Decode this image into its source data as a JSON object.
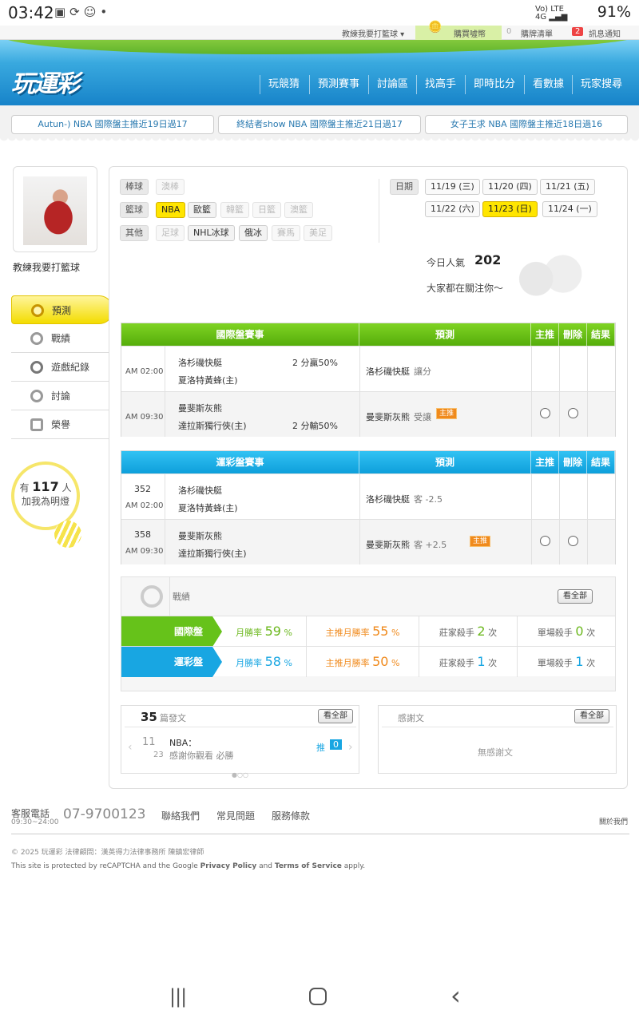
{
  "status": {
    "time": "03:42",
    "battery": "91%",
    "net1": "Vo) LTE",
    "net2": "4G"
  },
  "topbar": {
    "user": "教練我要打籃球 ▾",
    "coins": "購買噓幣",
    "cart": "購牌清單",
    "cart_count": "0",
    "notify_count": "2",
    "notify": "訊息通知"
  },
  "header": {
    "logo": "玩運彩",
    "nav": [
      "玩競猜",
      "預測賽事",
      "討論區",
      "找高手",
      "即時比分",
      "看數據",
      "玩家搜尋"
    ]
  },
  "ticker": [
    "Autun-)  NBA  國際盤主推近19日過17",
    "終結者show  NBA  國際盤主推近21日過17",
    "女子王求  NBA  國際盤主推近18日過16"
  ],
  "profile": {
    "name": "教練我要打籃球"
  },
  "sidemenu": [
    "預測",
    "戰績",
    "遊戲紀錄",
    "討論",
    "榮譽"
  ],
  "fans": {
    "prefix": "有",
    "count": "117",
    "suffix": "人",
    "line2": "加我為明燈"
  },
  "filters": {
    "baseball_label": "棒球",
    "baseball": [
      "澳棒"
    ],
    "basketball_label": "籃球",
    "basketball": [
      "NBA",
      "歐籃",
      "韓籃",
      "日籃",
      "澳籃"
    ],
    "other_label": "其他",
    "other": [
      "足球",
      "NHL冰球",
      "俄冰",
      "賽馬",
      "美足"
    ],
    "date_label": "日期",
    "dates": [
      "11/19 (三)",
      "11/20 (四)",
      "11/21 (五)",
      "11/22 (六)",
      "11/23 (日)",
      "11/24 (一)"
    ]
  },
  "popularity": {
    "label": "今日人氣",
    "value": "202",
    "sub": "大家都在關注你～"
  },
  "intl_table": {
    "headers": [
      "國際盤賽事",
      "預測",
      "主推",
      "刪除",
      "結果"
    ],
    "rows": [
      {
        "time": "AM 02:00",
        "team1": "洛杉磯快艇",
        "team2": "夏洛特黃蜂(主)",
        "odds": "2 分贏50%",
        "pick": "洛杉磯快艇",
        "pick_type": "讓分",
        "main": ""
      },
      {
        "time": "AM 09:30",
        "team1": "曼斐斯灰熊",
        "team2": "達拉斯獨行俠(主)",
        "odds": "2 分輸50%",
        "pick": "曼斐斯灰熊",
        "pick_type": "受讓",
        "main": "主推"
      }
    ]
  },
  "lottery_table": {
    "headers": [
      "運彩盤賽事",
      "預測",
      "主推",
      "刪除",
      "結果"
    ],
    "rows": [
      {
        "no": "352",
        "time": "AM 02:00",
        "team1": "洛杉磯快艇",
        "team2": "夏洛特黃蜂(主)",
        "pick": "洛杉磯快艇",
        "pick_type": "客 -2.5",
        "main": ""
      },
      {
        "no": "358",
        "time": "AM 09:30",
        "team1": "曼斐斯灰熊",
        "team2": "達拉斯獨行俠(主)",
        "pick": "曼斐斯灰熊",
        "pick_type": "客 +2.5",
        "main": "主推"
      }
    ]
  },
  "record": {
    "title": "戰績",
    "view_all": "看全部",
    "rows": [
      {
        "tag": "國際盤",
        "win_label": "月勝率",
        "win": "59",
        "main_label": "主推月勝率",
        "main": "55",
        "pct": "%",
        "killer_label": "莊家殺手",
        "killer": "2",
        "single_label": "單場殺手",
        "single": "0",
        "unit": "次"
      },
      {
        "tag": "運彩盤",
        "win_label": "月勝率",
        "win": "58",
        "main_label": "主推月勝率",
        "main": "50",
        "pct": "%",
        "killer_label": "莊家殺手",
        "killer": "1",
        "single_label": "單場殺手",
        "single": "1",
        "unit": "次"
      }
    ]
  },
  "posts": {
    "count": "35",
    "label": "篇發文",
    "view_all": "看全部",
    "month": "11",
    "day": "23",
    "title": "NBA：",
    "sub": "感謝你觀看 必勝",
    "push_label": "推",
    "push": "0"
  },
  "thanks": {
    "label": "感謝文",
    "view_all": "看全部",
    "empty": "無感謝文"
  },
  "footer": {
    "service_label": "客服電話",
    "hours": "09:30~24:00",
    "phone": "07-9700123",
    "links": [
      "聯絡我們",
      "常見問題",
      "服務條款"
    ],
    "about": "關於我們",
    "copyright": "© 2025 玩運彩  法律顧問：漢英得力法律事務所 陳鎮宏律師",
    "recaptcha_pre": "This site is protected by reCAPTCHA and the Google ",
    "privacy": "Privacy Policy",
    "and": " and ",
    "terms": "Terms of Service",
    "apply": " apply."
  }
}
